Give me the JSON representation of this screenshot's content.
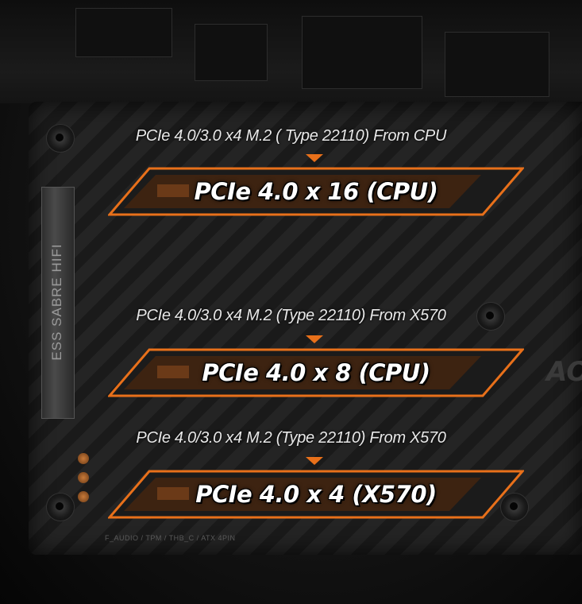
{
  "background": {
    "audio_label": "ESS SABRE HIFI",
    "board_logo": "AO",
    "header_label": "F_AUDIO / TPM / THB_C / ATX 4PIN"
  },
  "accent_color": "#e8701a",
  "slots": [
    {
      "caption": "PCIe 4.0/3.0 x4 M.2 ( Type 22110) From CPU",
      "label": "PCIe 4.0 x 16 (CPU)"
    },
    {
      "caption": "PCIe 4.0/3.0 x4 M.2 (Type 22110) From X570",
      "label": "PCIe 4.0 x 8 (CPU)"
    },
    {
      "caption": "PCIe 4.0/3.0 x4 M.2 (Type 22110) From X570",
      "label": "PCIe 4.0 x 4 (X570)"
    }
  ]
}
